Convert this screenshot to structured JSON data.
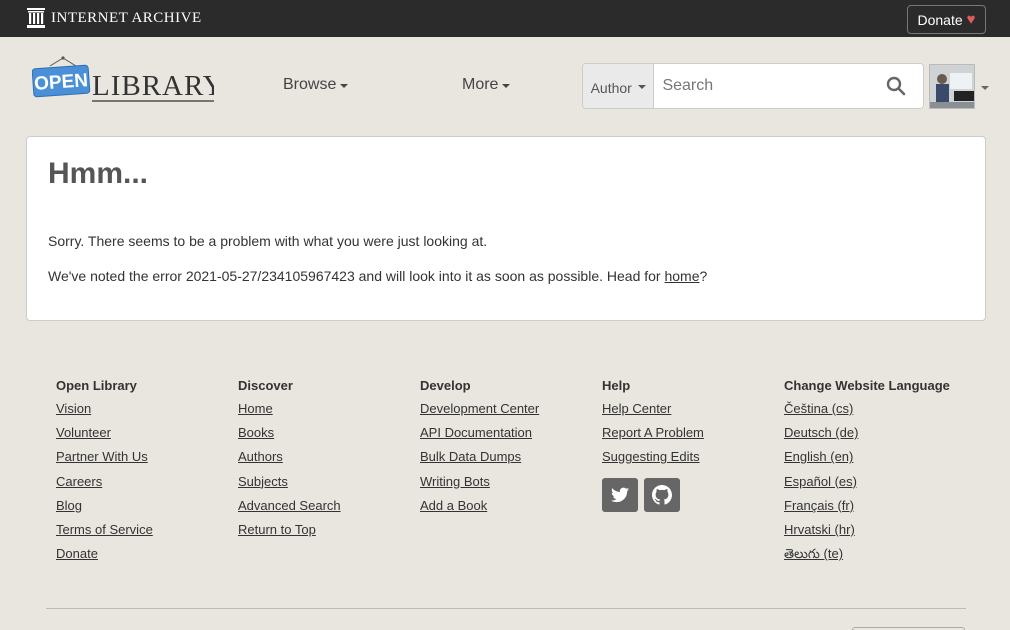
{
  "topbar": {
    "brand": "INTERNET ARCHIVE",
    "donate_label": "Donate",
    "donate_heart": "♥",
    "icons": {
      "logo": "internet-archive-temple-icon",
      "heart": "heart-icon"
    }
  },
  "header": {
    "logo_open": "OPEN",
    "logo_library": "LIBRARY",
    "nav": [
      {
        "label": "Browse"
      },
      {
        "label": "More"
      }
    ],
    "search": {
      "type_label": "Author",
      "placeholder": "Search",
      "value": ""
    }
  },
  "error": {
    "title": "Hmm...",
    "line1": "Sorry. There seems to be a problem with what you were just looking at.",
    "line2_prefix": "We've noted the error 2021-05-27/234105967423 and will look into it as soon as possible. Head for ",
    "line2_link": "home",
    "line2_suffix": "?"
  },
  "footer": {
    "columns": [
      {
        "heading": "Open Library",
        "links": [
          "Vision",
          "Volunteer",
          "Partner With Us",
          "Careers",
          "Blog",
          "Terms of Service",
          "Donate"
        ]
      },
      {
        "heading": "Discover",
        "links": [
          "Home",
          "Books",
          "Authors",
          "Subjects",
          "Advanced Search",
          "Return to Top"
        ]
      },
      {
        "heading": "Develop",
        "links": [
          "Development Center",
          "API Documentation",
          "Bulk Data Dumps",
          "Writing Bots",
          "Add a Book"
        ]
      },
      {
        "heading": "Help",
        "links": [
          "Help Center",
          "Report A Problem",
          "Suggesting Edits"
        ]
      },
      {
        "heading": "Change Website Language",
        "links": [
          "Čeština (cs)",
          "Deutsch (de)",
          "English (en)",
          "Español (es)",
          "Français (fr)",
          "Hrvatski (hr)",
          "తెలుగు (te)"
        ]
      }
    ],
    "social": [
      "twitter-icon",
      "github-icon"
    ]
  },
  "colors": {
    "page_bg": "#e9e6df",
    "topbar_bg": "#2b2b2b",
    "heart": "#e35b57",
    "logo_blue": "#4a90d9"
  }
}
